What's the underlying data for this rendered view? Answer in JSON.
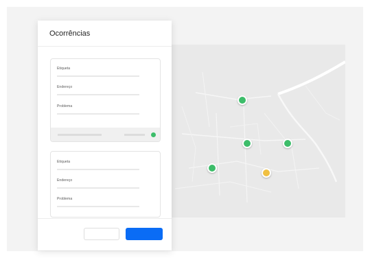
{
  "panel": {
    "title": "Ocorrências"
  },
  "cards": [
    {
      "fields": [
        {
          "label": "Etiqueta"
        },
        {
          "label": "Endereço"
        },
        {
          "label": "Problema"
        }
      ],
      "status_color": "#3dbd6a"
    },
    {
      "fields": [
        {
          "label": "Etiqueta"
        },
        {
          "label": "Endereço"
        },
        {
          "label": "Problema"
        }
      ]
    }
  ],
  "buttons": {
    "cancel_label": "",
    "confirm_label": ""
  },
  "map": {
    "markers": [
      {
        "status": "green",
        "color": "#3dbd6a"
      },
      {
        "status": "green",
        "color": "#3dbd6a"
      },
      {
        "status": "green",
        "color": "#3dbd6a"
      },
      {
        "status": "green",
        "color": "#3dbd6a"
      },
      {
        "status": "yellow",
        "color": "#f0c042"
      }
    ]
  },
  "colors": {
    "accent": "#0a6cf5",
    "marker_green": "#3dbd6a",
    "marker_yellow": "#f0c042"
  }
}
